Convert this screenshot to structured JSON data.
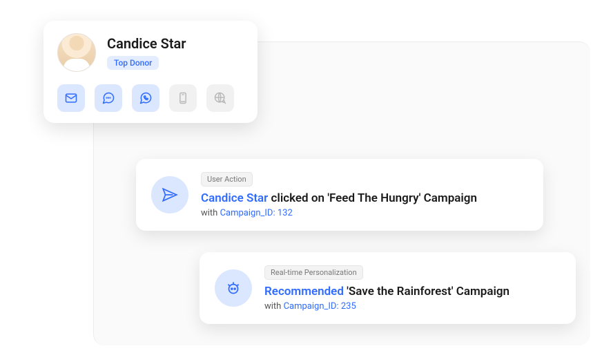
{
  "profile": {
    "name": "Candice Star",
    "badge": "Top Donor"
  },
  "events": [
    {
      "chip": "User Action",
      "actor": "Candice Star",
      "verb": " clicked on ",
      "object": "'Feed The Hungry' Campaign",
      "sub_prefix": "with ",
      "sub_link": "Campaign_ID: 132"
    },
    {
      "chip": "Real-time Personalization",
      "actor": "Recommended",
      "verb": " ",
      "object": "'Save the Rainforest' Campaign",
      "sub_prefix": "with ",
      "sub_link": "Campaign_ID: 235"
    }
  ]
}
